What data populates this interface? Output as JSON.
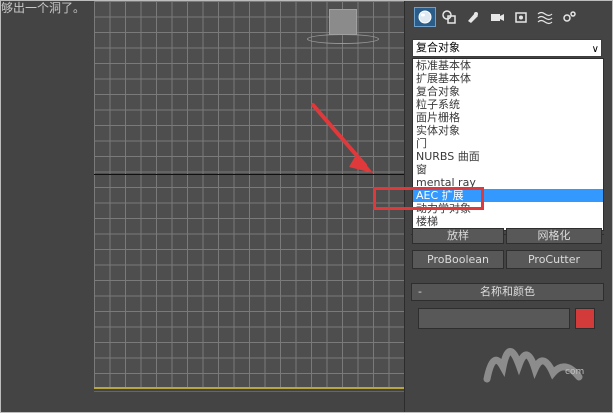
{
  "caption": {
    "text": "够出一个洞了。"
  },
  "command_panel": {
    "toolbar_icons": [
      {
        "name": "geometry-sphere-icon",
        "active": true
      },
      {
        "name": "shapes-icon",
        "active": false
      },
      {
        "name": "lights-icon",
        "active": false
      },
      {
        "name": "cameras-icon",
        "active": false
      },
      {
        "name": "helpers-icon",
        "active": false
      },
      {
        "name": "space-warps-icon",
        "active": false
      },
      {
        "name": "systems-icon",
        "active": false
      }
    ],
    "category_dropdown": {
      "selected": "复合对象",
      "arrow": "∨",
      "options": [
        "标准基本体",
        "扩展基本体",
        "复合对象",
        "粒子系统",
        "面片栅格",
        "实体对象",
        "门",
        "NURBS 曲面",
        "窗",
        "mental ray",
        "AEC 扩展",
        "动力学对象",
        "楼梯"
      ],
      "highlighted": "AEC 扩展"
    },
    "object_buttons": [
      "放样",
      "网格化",
      "ProBoolean",
      "ProCutter"
    ],
    "name_and_color": {
      "toggle": "-",
      "title": "名称和颜色",
      "name_value": "",
      "color": "#d33b3b"
    },
    "watermark_text": "com"
  },
  "viewport": {
    "grid_color": "#7a7a7a",
    "background": "#444444",
    "annotation_color": "#e0393b"
  }
}
